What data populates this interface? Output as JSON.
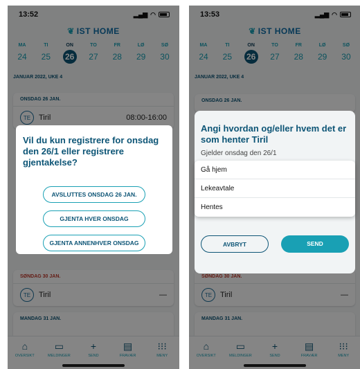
{
  "left": {
    "time": "13:52",
    "logo": "IST HOME",
    "week": [
      {
        "name": "MA",
        "num": "24"
      },
      {
        "name": "TI",
        "num": "25"
      },
      {
        "name": "ON",
        "num": "26"
      },
      {
        "name": "TO",
        "num": "27"
      },
      {
        "name": "FR",
        "num": "28"
      },
      {
        "name": "LØ",
        "num": "29"
      },
      {
        "name": "SØ",
        "num": "30"
      }
    ],
    "month_label": "JANUAR 2022, UKE 4",
    "card1_header": "ONSDAG 26 JAN.",
    "card1_avatar": "TE",
    "card1_name": "Tiril",
    "card1_time": "08:00-16:00",
    "card2_header": "SØNDAG 30 JAN.",
    "card2_avatar": "TE",
    "card2_name": "Tiril",
    "card2_right": "—",
    "card3_header": "MANDAG 31 JAN.",
    "modal_title": "Vil du kun registrere for onsdag den 26/1 eller registrere gjentakelse?",
    "buttons": [
      "AVSLUTTES ONSDAG 26 JAN.",
      "GJENTA HVER ONSDAG",
      "GJENTA ANNENHVER ONSDAG"
    ],
    "tabs": [
      "OVERSIKT",
      "MELDINGER",
      "SEND",
      "FRAVÆR",
      "MENY"
    ]
  },
  "right": {
    "time": "13:53",
    "logo": "IST HOME",
    "week": [
      {
        "name": "MA",
        "num": "24"
      },
      {
        "name": "TI",
        "num": "25"
      },
      {
        "name": "ON",
        "num": "26"
      },
      {
        "name": "TO",
        "num": "27"
      },
      {
        "name": "FR",
        "num": "28"
      },
      {
        "name": "LØ",
        "num": "29"
      },
      {
        "name": "SØ",
        "num": "30"
      }
    ],
    "month_label": "JANUAR 2022, UKE 4",
    "card1_header": "ONSDAG 26 JAN.",
    "card2_header": "SØNDAG 30 JAN.",
    "card2_avatar": "TE",
    "card2_name": "Tiril",
    "card2_right": "—",
    "card3_header": "MANDAG 31 JAN.",
    "modal_title": "Angi hvordan og/eller hvem det er som henter Tiril",
    "modal_sub": "Gjelder onsdag den 26/1",
    "options": [
      "Gå hjem",
      "Lekeavtale",
      "Hentes"
    ],
    "cancel": "AVBRYT",
    "send": "SEND",
    "tabs": [
      "OVERSIKT",
      "MELDINGER",
      "SEND",
      "FRAVÆR",
      "MENY"
    ]
  },
  "colors": {
    "primary": "#0d5576",
    "accent": "#19a0b4",
    "danger": "#c0392b"
  }
}
